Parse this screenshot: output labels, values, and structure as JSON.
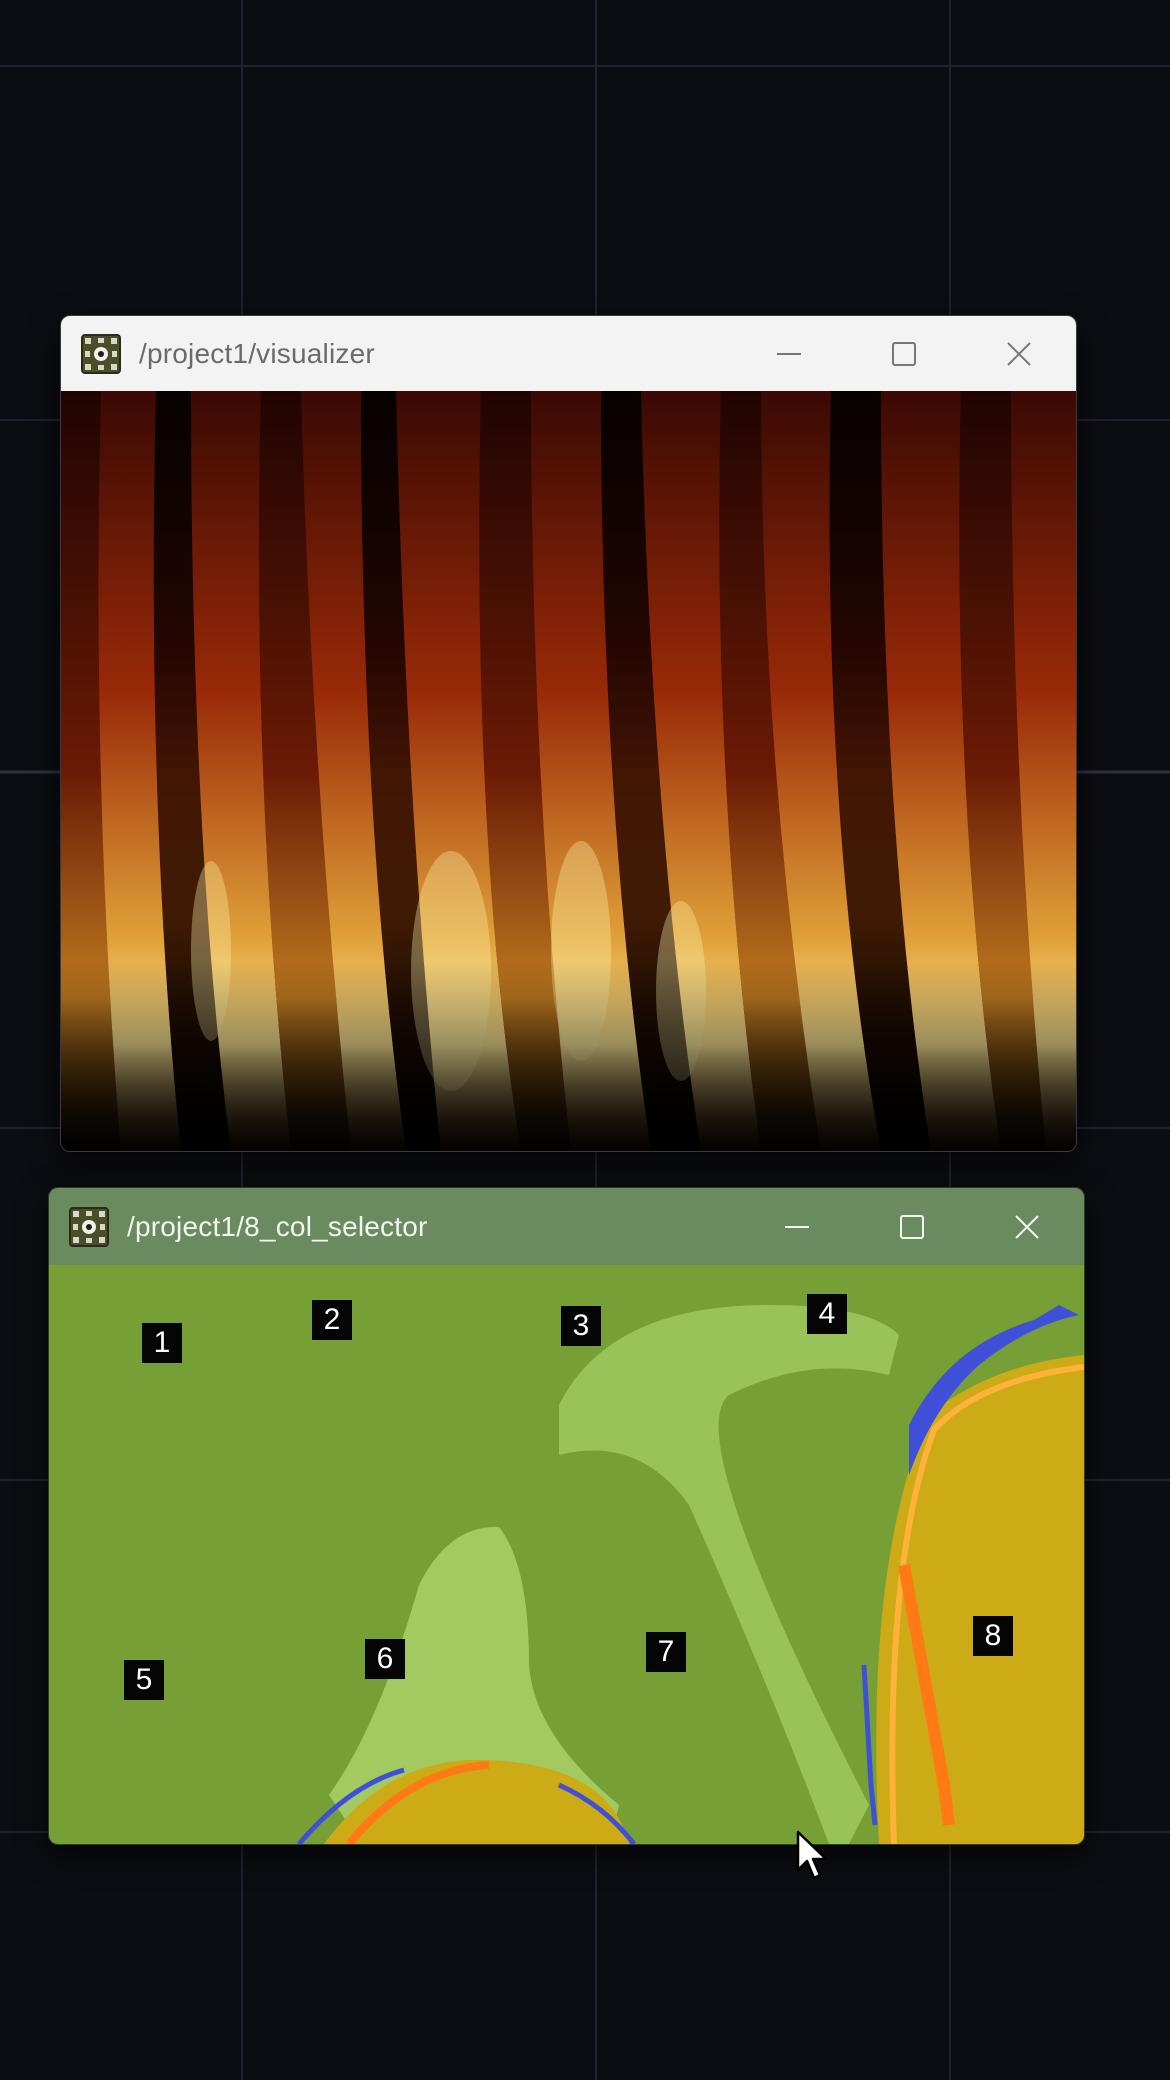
{
  "windows": {
    "visualizer": {
      "title": "/project1/visualizer",
      "icon": "touchdesigner-app-icon",
      "controls": {
        "minimize": "minimize-icon",
        "maximize": "maximize-icon",
        "close": "close-icon"
      },
      "content": "flame-curtain-render"
    },
    "selector": {
      "title": "/project1/8_col_selector",
      "icon": "touchdesigner-app-icon",
      "controls": {
        "minimize": "minimize-icon",
        "maximize": "maximize-icon",
        "close": "close-icon"
      },
      "markers": [
        "1",
        "2",
        "3",
        "4",
        "5",
        "6",
        "7",
        "8"
      ]
    }
  },
  "colors": {
    "background": "#0c0d12",
    "selector_green": "#76a036",
    "selector_light_green": "#a4cc64",
    "selector_yellow": "#ccab16",
    "selector_orange": "#ff7a14",
    "selector_blue": "#3f4fd8",
    "visualizer_red": "#7a1406",
    "visualizer_gold": "#ffe07a"
  }
}
